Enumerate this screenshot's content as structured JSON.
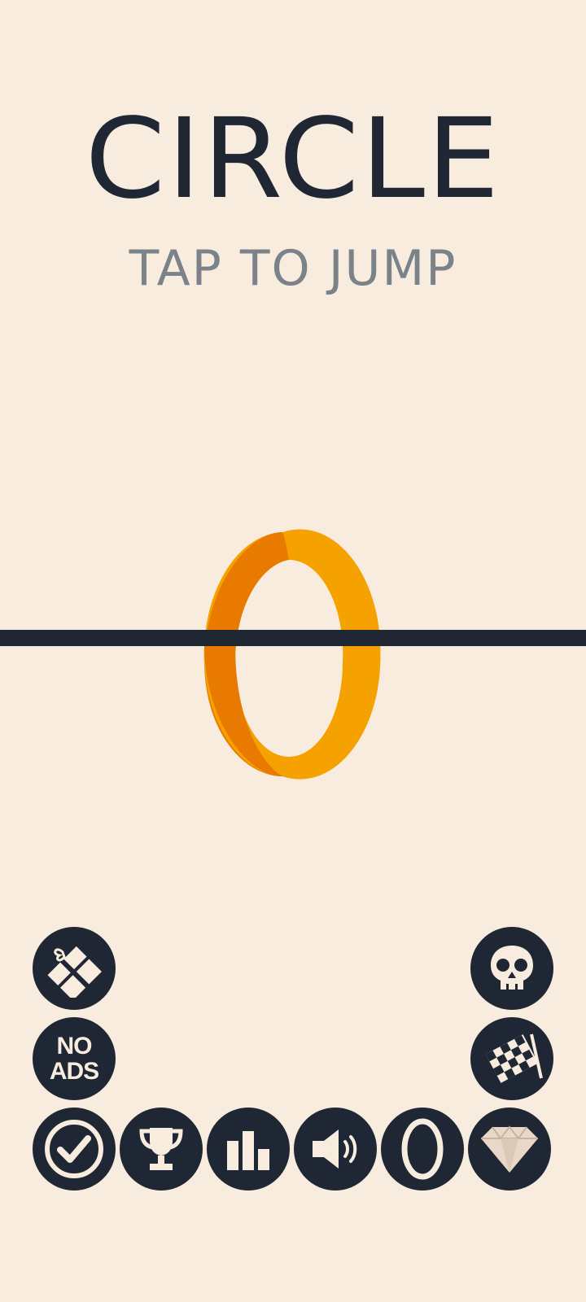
{
  "title": "CIRCLE",
  "subtitle": "TAP TO JUMP",
  "colors": {
    "background": "#f8ecdf",
    "dark": "#1e2733",
    "ring": "#f5a100",
    "ring_inner": "#e87a00",
    "subtitle": "#7b8288"
  },
  "buttons": {
    "noads": {
      "line1": "NO",
      "line2": "ADS"
    },
    "gift": {
      "icon": "gift-icon"
    },
    "skull": {
      "icon": "skull-icon"
    },
    "flag": {
      "icon": "checkered-flag-icon"
    },
    "check": {
      "icon": "checkmark-icon"
    },
    "trophy": {
      "icon": "trophy-icon"
    },
    "leaderboard": {
      "icon": "bar-chart-icon"
    },
    "sound": {
      "icon": "speaker-icon"
    },
    "ring": {
      "icon": "ring-icon"
    },
    "gem": {
      "icon": "diamond-icon"
    }
  }
}
